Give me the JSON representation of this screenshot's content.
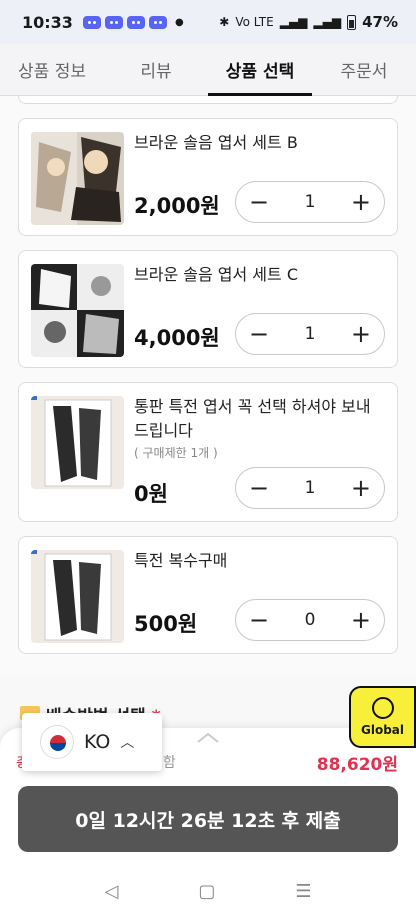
{
  "status_bar": {
    "time": "10:33",
    "net": "Vo LTE",
    "battery": "47%"
  },
  "tabs": [
    {
      "label": "상품 정보"
    },
    {
      "label": "리뷰"
    },
    {
      "label": "상품 선택"
    },
    {
      "label": "주문서"
    }
  ],
  "products": [
    {
      "name": "브라운 솔음 엽서 세트 B",
      "price": "2,000원",
      "qty": "1",
      "limit": ""
    },
    {
      "name": "브라운 솔음 엽서 세트 C",
      "price": "4,000원",
      "qty": "1",
      "limit": ""
    },
    {
      "name": "통판 특전 엽서 꼭 선택 하셔야 보내드립니다",
      "price": "0원",
      "qty": "1",
      "limit": "( 구매제한 1개 )"
    },
    {
      "name": "특전 복수구매",
      "price": "500원",
      "qty": "0",
      "limit": ""
    }
  ],
  "shipping": {
    "title": "배송방법 선택",
    "required_mark": "*"
  },
  "summary": {
    "total_note": "포함",
    "total_amount": "88,620원",
    "red_prefix": "총"
  },
  "submit_label": "0일 12시간 26분 12초 후 제출",
  "language": {
    "code": "KO"
  },
  "global_button": {
    "label": "Global"
  },
  "nav": {
    "back": "◁",
    "home": "▢",
    "recent": "☰"
  }
}
